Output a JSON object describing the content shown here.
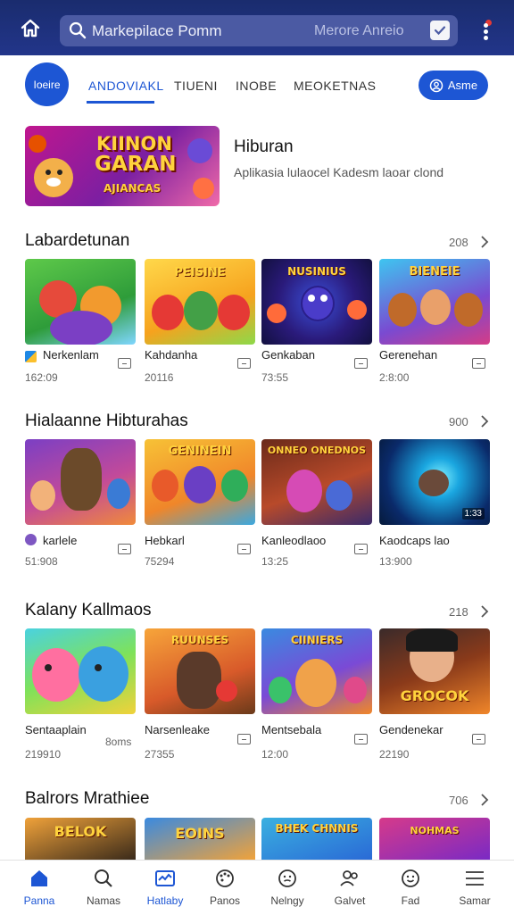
{
  "header": {
    "search_text": "Markepilace Pomm",
    "search_right_text": "Merore Anreio",
    "colors": {
      "bar": "#1a2c6e",
      "search_bg": "#4b5aa3",
      "accent": "#1d56d4",
      "badge": "#e53935"
    },
    "icons": [
      "home-icon",
      "search-icon",
      "check-icon",
      "more-vertical-icon"
    ]
  },
  "tabs_row": {
    "logo_label": "Ioeire",
    "tabs": [
      {
        "label": "ANDOVIAKL",
        "active": true
      },
      {
        "label": "TIUENI",
        "active": false
      },
      {
        "label": "INOBE",
        "active": false
      },
      {
        "label": "MEOKETNAS",
        "active": false
      }
    ],
    "pill_label": "Asme",
    "pill_icon": "user-circle-icon"
  },
  "banner": {
    "art_line1": "KIINON",
    "art_line2": "GARAN",
    "art_line3": "AJIANCAS",
    "title": "Hiburan",
    "subtitle": "Aplikasia lulaocel Kadesm laoar clond"
  },
  "sections": [
    {
      "title": "Labardetunan",
      "count": "208",
      "items": [
        {
          "name": "Nerkenlam",
          "meta": "162:09",
          "art": "",
          "has_small_icon": true
        },
        {
          "name": "Kahdanha",
          "meta": "20116",
          "art": "PEISINE"
        },
        {
          "name": "Genkaban",
          "meta": "73:55",
          "art": "NUSINIUS"
        },
        {
          "name": "Gerenehan",
          "meta": "2:8:00",
          "art": "BIENEIE"
        }
      ]
    },
    {
      "title": "Hialaanne Hibturahas",
      "count": "900",
      "items": [
        {
          "name": "karlele",
          "meta": "51:908",
          "art": "",
          "has_small_icon": true
        },
        {
          "name": "Hebkarl",
          "meta": "75294",
          "art": "GENINEIN"
        },
        {
          "name": "Kanleodlaoo",
          "meta": "13:25",
          "art": "ONNEO ONEDNOS"
        },
        {
          "name": "Kaodcaps lao",
          "meta": "13:900",
          "art": "",
          "corner_tag": "1:33"
        }
      ]
    },
    {
      "title": "Kalany Kallmaos",
      "count": "218",
      "items": [
        {
          "name": "Sentaaplain",
          "meta": "219910",
          "art": "",
          "right_text": "8oms"
        },
        {
          "name": "Narsenleake",
          "meta": "27355",
          "art": "RUUNSES"
        },
        {
          "name": "Mentsebala",
          "meta": "12:00",
          "art": "CIINIERS"
        },
        {
          "name": "Gendenekar",
          "meta": "22190",
          "art": "GROCOK"
        }
      ]
    },
    {
      "title": "Balrors Mrathiee",
      "count": "706",
      "items": [
        {
          "name": "",
          "meta": "",
          "art": "BELOK"
        },
        {
          "name": "",
          "meta": "",
          "art": "EOINS"
        },
        {
          "name": "",
          "meta": "",
          "art": "BHEK CHNNIS"
        },
        {
          "name": "",
          "meta": "",
          "art": "NOHMAS"
        }
      ]
    }
  ],
  "bottom_nav": [
    {
      "label": "Panna",
      "icon": "home-icon",
      "active": true
    },
    {
      "label": "Namas",
      "icon": "search-icon",
      "active": false
    },
    {
      "label": "Hatlaby",
      "icon": "store-icon",
      "active": true
    },
    {
      "label": "Panos",
      "icon": "palette-icon",
      "active": false
    },
    {
      "label": "Nelngy",
      "icon": "smiley-icon",
      "active": false
    },
    {
      "label": "Galvet",
      "icon": "users-icon",
      "active": false
    },
    {
      "label": "Fad",
      "icon": "chat-smiley-icon",
      "active": false
    },
    {
      "label": "Samar",
      "icon": "menu-icon",
      "active": false
    }
  ]
}
